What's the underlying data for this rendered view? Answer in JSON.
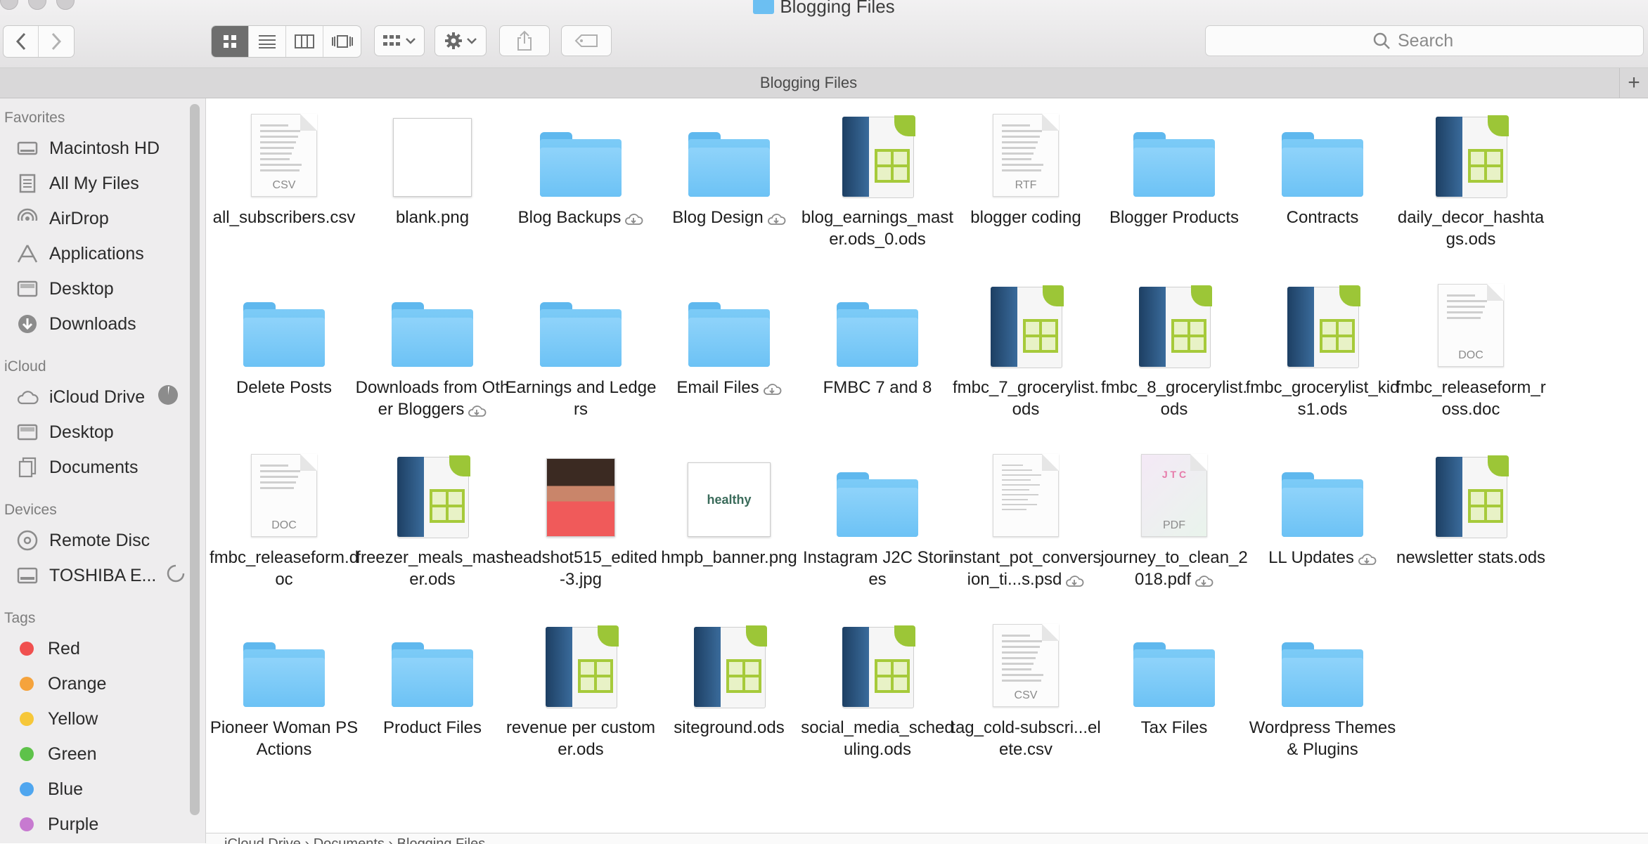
{
  "window": {
    "title": "Blogging Files"
  },
  "toolbar": {
    "search_placeholder": "Search",
    "view_modes": [
      "icon-view",
      "list-view",
      "column-view",
      "cover-flow-view"
    ],
    "active_view": "icon-view"
  },
  "tabbar": {
    "tab_label": "Blogging Files",
    "add_tab": "+"
  },
  "sidebar": {
    "favorites_heading": "Favorites",
    "favorites": [
      {
        "label": "Macintosh HD",
        "icon": "hard-drive-icon"
      },
      {
        "label": "All My Files",
        "icon": "all-files-icon"
      },
      {
        "label": "AirDrop",
        "icon": "airdrop-icon"
      },
      {
        "label": "Applications",
        "icon": "applications-icon"
      },
      {
        "label": "Desktop",
        "icon": "desktop-icon"
      },
      {
        "label": "Downloads",
        "icon": "downloads-icon"
      }
    ],
    "icloud_heading": "iCloud",
    "icloud": [
      {
        "label": "iCloud Drive",
        "icon": "cloud-icon"
      },
      {
        "label": "Desktop",
        "icon": "desktop-icon"
      },
      {
        "label": "Documents",
        "icon": "documents-icon"
      }
    ],
    "devices_heading": "Devices",
    "devices": [
      {
        "label": "Remote Disc",
        "icon": "disc-icon"
      },
      {
        "label": "TOSHIBA E...",
        "icon": "external-drive-icon"
      }
    ],
    "tags_heading": "Tags",
    "tags": [
      {
        "label": "Red",
        "color": "#f0504f"
      },
      {
        "label": "Orange",
        "color": "#f5a33c"
      },
      {
        "label": "Yellow",
        "color": "#f6c739"
      },
      {
        "label": "Green",
        "color": "#5ec24a"
      },
      {
        "label": "Blue",
        "color": "#4fa6ef"
      },
      {
        "label": "Purple",
        "color": "#c77ad0"
      }
    ]
  },
  "files": [
    {
      "name": "all_subscribers.csv",
      "kind": "csv"
    },
    {
      "name": "blank.png",
      "kind": "png-blank"
    },
    {
      "name": "Blog Backups",
      "kind": "folder",
      "cloud": true
    },
    {
      "name": "Blog Design",
      "kind": "folder",
      "cloud": true
    },
    {
      "name": "blog_earnings_master.ods_0.ods",
      "kind": "ods"
    },
    {
      "name": "blogger coding",
      "kind": "rtf"
    },
    {
      "name": "Blogger Products",
      "kind": "folder"
    },
    {
      "name": "Contracts",
      "kind": "folder"
    },
    {
      "name": "daily_decor_hashtags.ods",
      "kind": "ods"
    },
    {
      "name": "Delete Posts",
      "kind": "folder"
    },
    {
      "name": "Downloads from Other Bloggers",
      "kind": "folder",
      "cloud": true
    },
    {
      "name": "Earnings and Ledgers",
      "kind": "folder"
    },
    {
      "name": "Email Files",
      "kind": "folder",
      "cloud": true
    },
    {
      "name": "FMBC 7 and 8",
      "kind": "folder"
    },
    {
      "name": "fmbc_7_grocerylist.ods",
      "kind": "ods"
    },
    {
      "name": "fmbc_8_grocerylist.ods",
      "kind": "ods"
    },
    {
      "name": "fmbc_grocerylist_kids1.ods",
      "kind": "ods"
    },
    {
      "name": "fmbc_releaseform_ross.doc",
      "kind": "doc"
    },
    {
      "name": "fmbc_releaseform.doc",
      "kind": "doc"
    },
    {
      "name": "freezer_meals_master.ods",
      "kind": "ods"
    },
    {
      "name": "headshot515_edited-3.jpg",
      "kind": "photo"
    },
    {
      "name": "hmpb_banner.png",
      "kind": "banner",
      "banner_text": "healthy"
    },
    {
      "name": "Instagram J2C Stories",
      "kind": "folder"
    },
    {
      "name": "instant_pot_conversion_ti...s.psd",
      "kind": "psd",
      "cloud": true
    },
    {
      "name": "journey_to_clean_2018.pdf",
      "kind": "pdf",
      "cloud": true
    },
    {
      "name": "LL Updates",
      "kind": "folder",
      "cloud": true
    },
    {
      "name": "newsletter stats.ods",
      "kind": "ods"
    },
    {
      "name": "Pioneer Woman PS Actions",
      "kind": "folder"
    },
    {
      "name": "Product Files",
      "kind": "folder"
    },
    {
      "name": "revenue per customer.ods",
      "kind": "ods"
    },
    {
      "name": "siteground.ods",
      "kind": "ods"
    },
    {
      "name": "social_media_scheduling.ods",
      "kind": "ods"
    },
    {
      "name": "tag_cold-subscri...elete.csv",
      "kind": "csv"
    },
    {
      "name": "Tax Files",
      "kind": "folder"
    },
    {
      "name": "Wordpress Themes & Plugins",
      "kind": "folder"
    }
  ],
  "pathbar": {
    "crumbs": [
      "iCloud Drive",
      "Documents",
      "Blogging Files"
    ]
  }
}
